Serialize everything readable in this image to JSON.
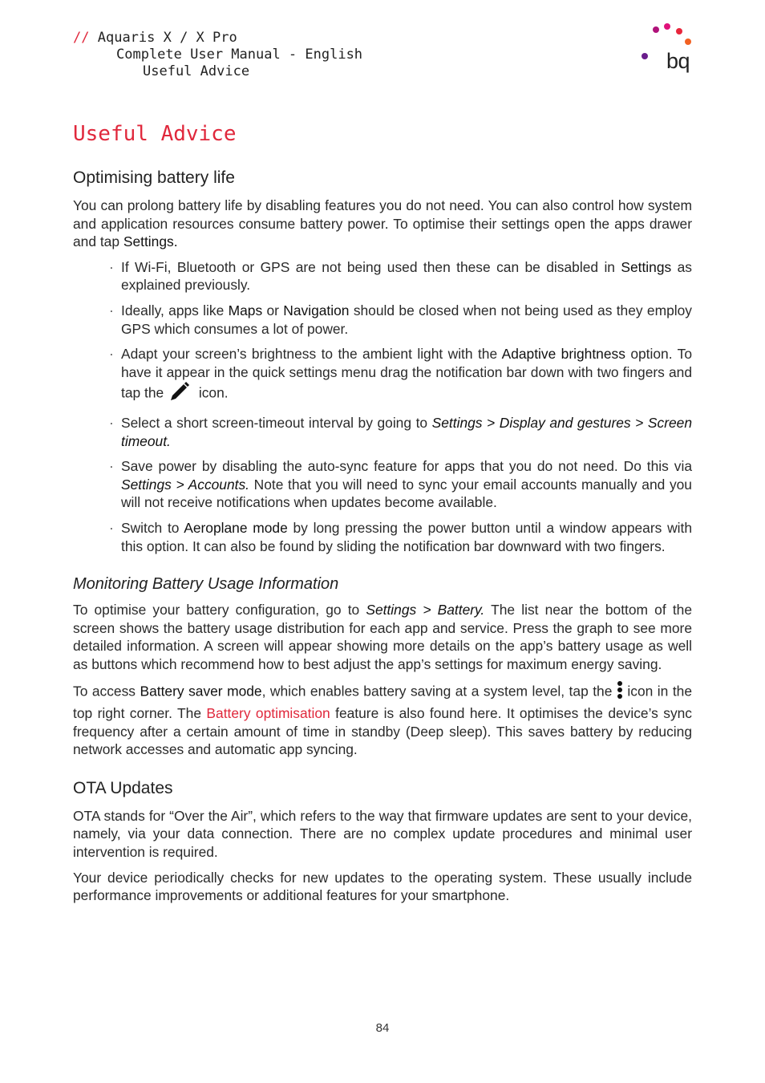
{
  "header": {
    "slashes": "//",
    "line1": "Aquaris X / X Pro",
    "line2": "Complete User Manual - English",
    "line3": "Useful Advice"
  },
  "logo": {
    "text": "bq",
    "dot_colors": [
      "#b0127a",
      "#e0127a",
      "#e8263c",
      "#f26122",
      "#6a1e8c"
    ]
  },
  "page_title": "Useful Advice",
  "sections": {
    "battery": {
      "heading": "Optimising battery life",
      "intro": [
        "You can prolong battery life by disabling features you do not need. You can also control how system and application resources consume battery power. To optimise their settings open the apps drawer and tap ",
        "Settings."
      ],
      "bullets": [
        [
          "If Wi-Fi, Bluetooth or GPS are not being used then these can be disabled in ",
          "Settings",
          " as explained previously."
        ],
        [
          "Ideally, apps like ",
          "Maps",
          " or ",
          "Navigation",
          " should be closed when not being used as they employ GPS which consumes a lot of power."
        ],
        [
          "Adapt your screen’s brightness to the ambient light with the ",
          "Adaptive brightness",
          " option. To have it appear in the quick settings menu drag the notification bar down with two fingers and tap the ",
          " icon."
        ],
        [
          "Select a short screen-timeout interval by going to ",
          "Settings > Display and gestures > Screen timeout."
        ],
        [
          "Save power by disabling the auto-sync feature for apps that you do not need. Do this via ",
          "Settings > Accounts.",
          " Note that you will need to sync your email accounts manually and you will not receive notifications when updates become available."
        ],
        [
          "Switch to ",
          "Aeroplane mode",
          " by long pressing the power button until a window appears with this option. It can also be found by sliding the notification bar downward with two fingers."
        ]
      ],
      "bullet_char": "·",
      "icons": {
        "edit": "pencil-icon",
        "menu": "more-vertical-icon"
      }
    },
    "monitoring": {
      "heading": "Monitoring Battery Usage Information",
      "p1": [
        "To optimise your battery configuration, go to ",
        "Settings > Battery.",
        " The list near the bottom of the screen shows the battery usage distribution for each app and service. Press the graph to see more detailed information. A screen will appear showing more details on the app’s battery usage as well as buttons which recommend how to best adjust the app’s settings for maximum energy saving."
      ],
      "p2": [
        "To access ",
        "Battery saver mode",
        ", which enables battery saving at a system level, tap the ",
        " icon in the top right corner. The ",
        "Battery optimisation",
        " feature is also found here. It optimises the device’s sync frequency after a certain amount of time in standby (Deep sleep). This saves battery by reducing network accesses and automatic app syncing."
      ]
    },
    "ota": {
      "heading": "OTA Updates",
      "p1": "OTA stands for “Over the Air”, which refers to the way that firmware updates are sent to your device, namely, via your data connection. There are no complex update procedures and minimal user intervention is required.",
      "p2": "Your device periodically checks for new updates to the operating system. These usually include performance improvements or additional features for your smartphone."
    }
  },
  "page_number": "84",
  "colors": {
    "accent": "#e0283c",
    "text": "#2a2a2a"
  }
}
